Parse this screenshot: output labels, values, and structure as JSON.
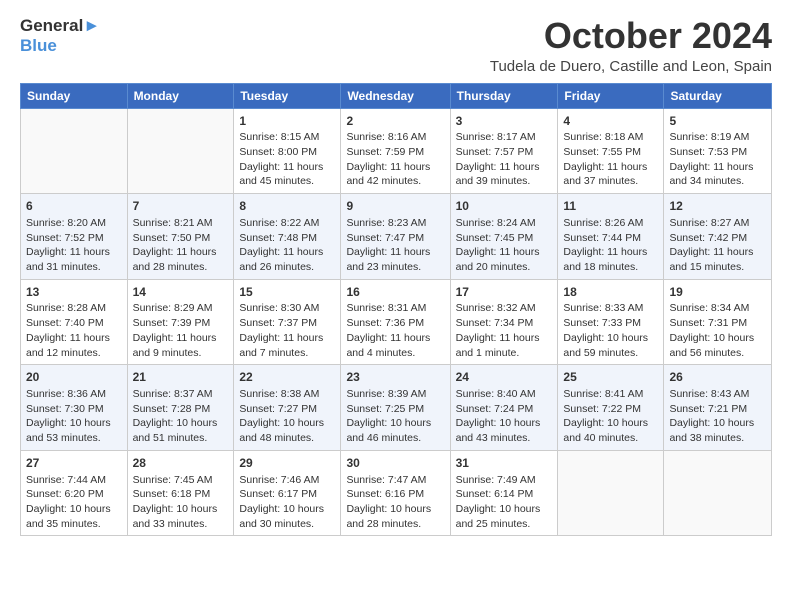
{
  "logo": {
    "line1": "General",
    "line2": "Blue"
  },
  "title": "October 2024",
  "subtitle": "Tudela de Duero, Castille and Leon, Spain",
  "days_of_week": [
    "Sunday",
    "Monday",
    "Tuesday",
    "Wednesday",
    "Thursday",
    "Friday",
    "Saturday"
  ],
  "weeks": [
    [
      {
        "day": "",
        "info": ""
      },
      {
        "day": "",
        "info": ""
      },
      {
        "day": "1",
        "info": "Sunrise: 8:15 AM\nSunset: 8:00 PM\nDaylight: 11 hours and 45 minutes."
      },
      {
        "day": "2",
        "info": "Sunrise: 8:16 AM\nSunset: 7:59 PM\nDaylight: 11 hours and 42 minutes."
      },
      {
        "day": "3",
        "info": "Sunrise: 8:17 AM\nSunset: 7:57 PM\nDaylight: 11 hours and 39 minutes."
      },
      {
        "day": "4",
        "info": "Sunrise: 8:18 AM\nSunset: 7:55 PM\nDaylight: 11 hours and 37 minutes."
      },
      {
        "day": "5",
        "info": "Sunrise: 8:19 AM\nSunset: 7:53 PM\nDaylight: 11 hours and 34 minutes."
      }
    ],
    [
      {
        "day": "6",
        "info": "Sunrise: 8:20 AM\nSunset: 7:52 PM\nDaylight: 11 hours and 31 minutes."
      },
      {
        "day": "7",
        "info": "Sunrise: 8:21 AM\nSunset: 7:50 PM\nDaylight: 11 hours and 28 minutes."
      },
      {
        "day": "8",
        "info": "Sunrise: 8:22 AM\nSunset: 7:48 PM\nDaylight: 11 hours and 26 minutes."
      },
      {
        "day": "9",
        "info": "Sunrise: 8:23 AM\nSunset: 7:47 PM\nDaylight: 11 hours and 23 minutes."
      },
      {
        "day": "10",
        "info": "Sunrise: 8:24 AM\nSunset: 7:45 PM\nDaylight: 11 hours and 20 minutes."
      },
      {
        "day": "11",
        "info": "Sunrise: 8:26 AM\nSunset: 7:44 PM\nDaylight: 11 hours and 18 minutes."
      },
      {
        "day": "12",
        "info": "Sunrise: 8:27 AM\nSunset: 7:42 PM\nDaylight: 11 hours and 15 minutes."
      }
    ],
    [
      {
        "day": "13",
        "info": "Sunrise: 8:28 AM\nSunset: 7:40 PM\nDaylight: 11 hours and 12 minutes."
      },
      {
        "day": "14",
        "info": "Sunrise: 8:29 AM\nSunset: 7:39 PM\nDaylight: 11 hours and 9 minutes."
      },
      {
        "day": "15",
        "info": "Sunrise: 8:30 AM\nSunset: 7:37 PM\nDaylight: 11 hours and 7 minutes."
      },
      {
        "day": "16",
        "info": "Sunrise: 8:31 AM\nSunset: 7:36 PM\nDaylight: 11 hours and 4 minutes."
      },
      {
        "day": "17",
        "info": "Sunrise: 8:32 AM\nSunset: 7:34 PM\nDaylight: 11 hours and 1 minute."
      },
      {
        "day": "18",
        "info": "Sunrise: 8:33 AM\nSunset: 7:33 PM\nDaylight: 10 hours and 59 minutes."
      },
      {
        "day": "19",
        "info": "Sunrise: 8:34 AM\nSunset: 7:31 PM\nDaylight: 10 hours and 56 minutes."
      }
    ],
    [
      {
        "day": "20",
        "info": "Sunrise: 8:36 AM\nSunset: 7:30 PM\nDaylight: 10 hours and 53 minutes."
      },
      {
        "day": "21",
        "info": "Sunrise: 8:37 AM\nSunset: 7:28 PM\nDaylight: 10 hours and 51 minutes."
      },
      {
        "day": "22",
        "info": "Sunrise: 8:38 AM\nSunset: 7:27 PM\nDaylight: 10 hours and 48 minutes."
      },
      {
        "day": "23",
        "info": "Sunrise: 8:39 AM\nSunset: 7:25 PM\nDaylight: 10 hours and 46 minutes."
      },
      {
        "day": "24",
        "info": "Sunrise: 8:40 AM\nSunset: 7:24 PM\nDaylight: 10 hours and 43 minutes."
      },
      {
        "day": "25",
        "info": "Sunrise: 8:41 AM\nSunset: 7:22 PM\nDaylight: 10 hours and 40 minutes."
      },
      {
        "day": "26",
        "info": "Sunrise: 8:43 AM\nSunset: 7:21 PM\nDaylight: 10 hours and 38 minutes."
      }
    ],
    [
      {
        "day": "27",
        "info": "Sunrise: 7:44 AM\nSunset: 6:20 PM\nDaylight: 10 hours and 35 minutes."
      },
      {
        "day": "28",
        "info": "Sunrise: 7:45 AM\nSunset: 6:18 PM\nDaylight: 10 hours and 33 minutes."
      },
      {
        "day": "29",
        "info": "Sunrise: 7:46 AM\nSunset: 6:17 PM\nDaylight: 10 hours and 30 minutes."
      },
      {
        "day": "30",
        "info": "Sunrise: 7:47 AM\nSunset: 6:16 PM\nDaylight: 10 hours and 28 minutes."
      },
      {
        "day": "31",
        "info": "Sunrise: 7:49 AM\nSunset: 6:14 PM\nDaylight: 10 hours and 25 minutes."
      },
      {
        "day": "",
        "info": ""
      },
      {
        "day": "",
        "info": ""
      }
    ]
  ]
}
